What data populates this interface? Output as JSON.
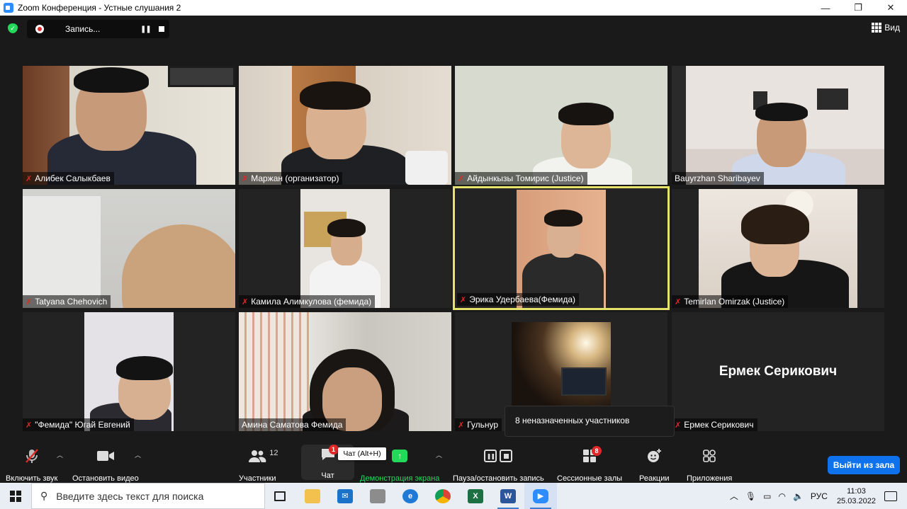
{
  "window": {
    "title": "Zoom Конференция - Устные слушания 2",
    "minimize": "—",
    "restore": "❐",
    "close": "✕"
  },
  "topbar": {
    "recording_label": "Запись...",
    "view_label": "Вид"
  },
  "participants": [
    {
      "name": "Алибек Салыкбаев",
      "muted": true
    },
    {
      "name": "Маржан (организатор)",
      "muted": true
    },
    {
      "name": "Айдынкызы Томирис (Justice)",
      "muted": true
    },
    {
      "name": "Bauyrzhan Sharibayev",
      "muted": false
    },
    {
      "name": "Tatyana Chehovich",
      "muted": true
    },
    {
      "name": "Камила Алимкулова (фемида)",
      "muted": true
    },
    {
      "name": "Эрика Удербаева(Фемида)",
      "muted": true,
      "active_speaker": true
    },
    {
      "name": "Temirlan Omirzak (Justice)",
      "muted": true
    },
    {
      "name": "\"Фемида\" Югай Евгений",
      "muted": true
    },
    {
      "name": "Амина Саматова Фемида",
      "muted": false
    },
    {
      "name": "Гульнур",
      "muted": true
    },
    {
      "name": "Ермек Серикович",
      "muted": true,
      "video_off_name": "Ермек Серикович"
    }
  ],
  "unassigned_tooltip": "8 неназначенных участников",
  "toolbar": {
    "unmute_label": "Включить звук",
    "stop_video_label": "Остановить видео",
    "participants_label": "Участники",
    "participants_count": "12",
    "chat_label": "Чат",
    "chat_badge": "1",
    "chat_tooltip": "Чат (Alt+H)",
    "share_label": "Демонстрация экрана",
    "pause_record_label": "Пауза/остановить запись",
    "breakout_label": "Сессионные залы",
    "breakout_badge": "8",
    "reactions_label": "Реакции",
    "apps_label": "Приложения",
    "leave_label": "Выйти из зала"
  },
  "taskbar": {
    "search_placeholder": "Введите здесь текст для поиска",
    "language": "РУС",
    "time": "11:03",
    "date": "25.03.2022"
  },
  "colors": {
    "zoom_bg": "#1a1a1a",
    "active_speaker_border": "#e6e36a",
    "leave_button": "#0e72ed",
    "share_green": "#23d959",
    "badge_red": "#e02828"
  }
}
